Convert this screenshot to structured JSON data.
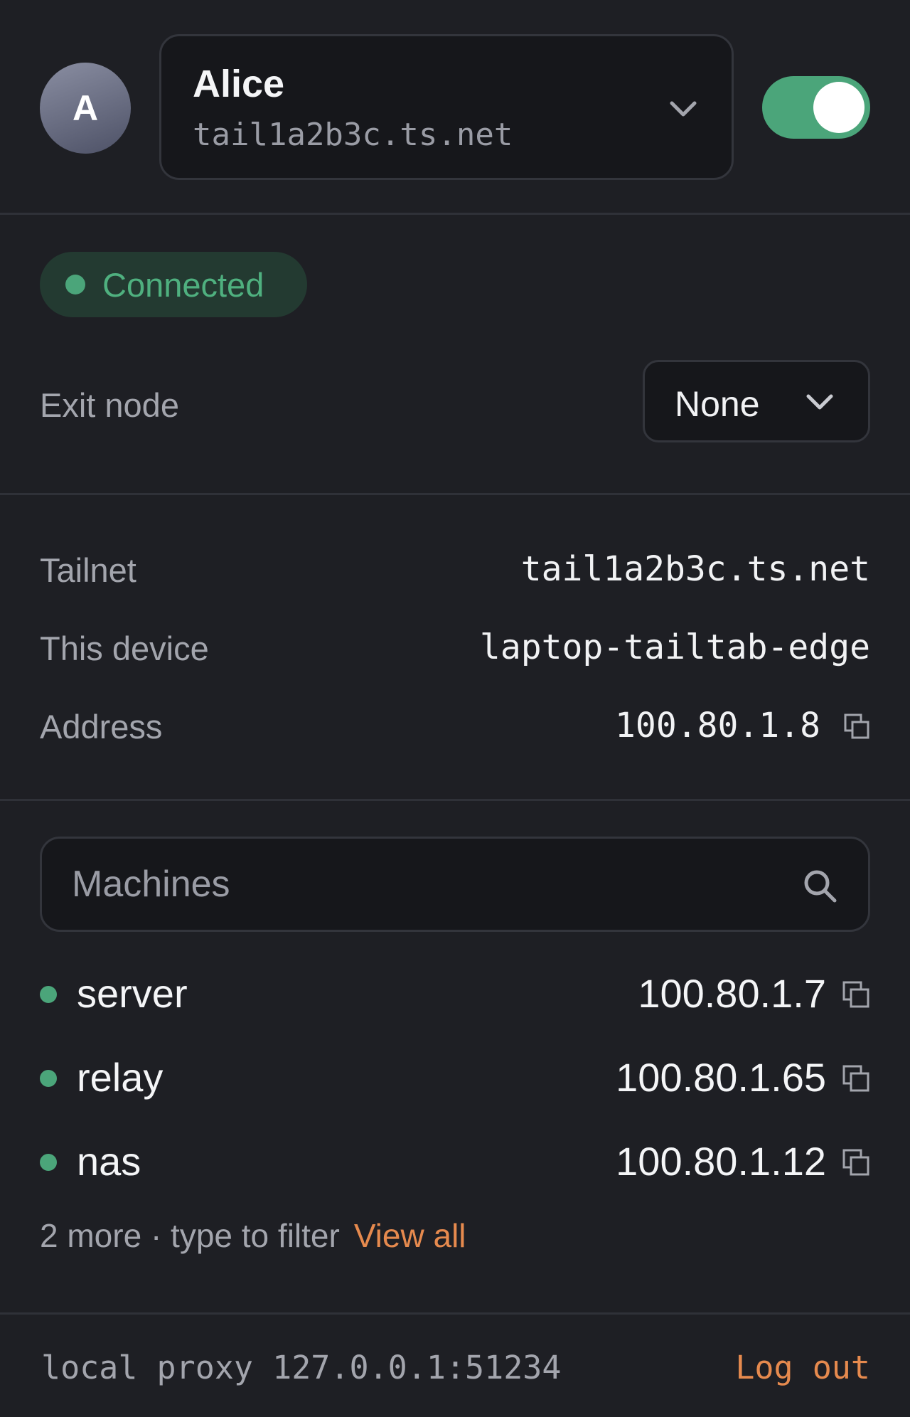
{
  "header": {
    "avatar_initial": "A",
    "account_name": "Alice",
    "account_tailnet": "tail1a2b3c.ts.net",
    "connection_toggle_on": true
  },
  "status": {
    "badge_label": "Connected",
    "exit_node_label": "Exit node",
    "exit_node_value": "None"
  },
  "info": {
    "tailnet_label": "Tailnet",
    "tailnet_value": "tail1a2b3c.ts.net",
    "device_label": "This device",
    "device_value": "laptop-tailtab-edge",
    "address_label": "Address",
    "address_value": "100.80.1.8"
  },
  "machines": {
    "search_placeholder": "Machines",
    "items": [
      {
        "name": "server",
        "ip": "100.80.1.7",
        "online": true
      },
      {
        "name": "relay",
        "ip": "100.80.1.65",
        "online": true
      },
      {
        "name": "nas",
        "ip": "100.80.1.12",
        "online": true
      }
    ],
    "more_text": "2 more · type to filter",
    "view_all_label": "View all"
  },
  "footer": {
    "proxy_text": "local proxy 127.0.0.1:51234",
    "logout_label": "Log out"
  },
  "colors": {
    "background": "#1e1f24",
    "accent_green": "#4ba57a",
    "accent_orange": "#e68a4e"
  },
  "icons": [
    "chevron-down-icon",
    "copy-icon",
    "search-icon",
    "status-dot-icon"
  ]
}
